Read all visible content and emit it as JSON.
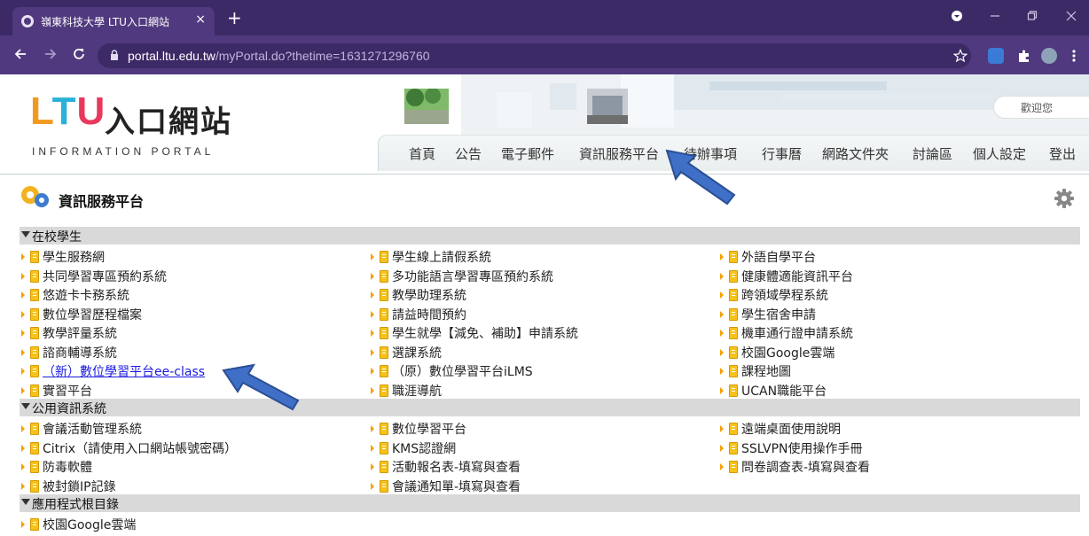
{
  "browser": {
    "tab_title": "嶺東科技大學 LTU入口網站",
    "tab_close": "×",
    "new_tab": "+",
    "url_host": "portal.ltu.edu.tw",
    "url_path": "/myPortal.do?thetime=1631271296760"
  },
  "logo": {
    "brand_l": "L",
    "brand_t": "T",
    "brand_u": "U",
    "title_cn": "入口網站",
    "subtitle_en": "INFORMATION PORTAL"
  },
  "header": {
    "greeting": "歡迎您"
  },
  "topnav": [
    "首頁",
    "公告",
    "電子郵件",
    "資訊服務平台",
    "待辦事項",
    "行事曆",
    "網路文件夾",
    "討論區",
    "個人設定",
    "登出"
  ],
  "panel": {
    "title": "資訊服務平台"
  },
  "sections": [
    {
      "title": "在校學生",
      "columns": [
        [
          "學生服務網",
          "共同學習專區預約系統",
          "悠遊卡卡務系統",
          "數位學習歷程檔案",
          "教學評量系統",
          "諮商輔導系統",
          "（新）數位學習平台ee-class",
          "實習平台"
        ],
        [
          "學生線上請假系統",
          "多功能語言學習專區預約系統",
          "教學助理系統",
          "請益時間預約",
          "學生就學【減免、補助】申請系統",
          "選課系統",
          "（原）數位學習平台iLMS",
          "職涯導航"
        ],
        [
          "外語自學平台",
          "健康體適能資訊平台",
          "跨領域學程系統",
          "學生宿舍申請",
          "機車通行證申請系統",
          "校園Google雲端",
          "課程地圖",
          "UCAN職能平台"
        ]
      ]
    },
    {
      "title": "公用資訊系統",
      "columns": [
        [
          "會議活動管理系統",
          "Citrix（請使用入口網站帳號密碼）",
          "防毒軟體",
          "被封鎖IP記錄"
        ],
        [
          "數位學習平台",
          "KMS認證網",
          "活動報名表-填寫與查看",
          "會議通知單-填寫與查看"
        ],
        [
          "遠端桌面使用說明",
          "SSLVPN使用操作手冊",
          "問卷調查表-填寫與查看"
        ]
      ]
    },
    {
      "title": "應用程式根目錄",
      "columns": [
        [
          "校園Google雲端"
        ]
      ]
    }
  ],
  "colors": {
    "browser_frame": "#3c2a66",
    "browser_toolbar": "#50397e",
    "section_bar": "#d9d9d9",
    "link": "#1a1ae0",
    "annotation_arrow": "#3f6fc7"
  }
}
